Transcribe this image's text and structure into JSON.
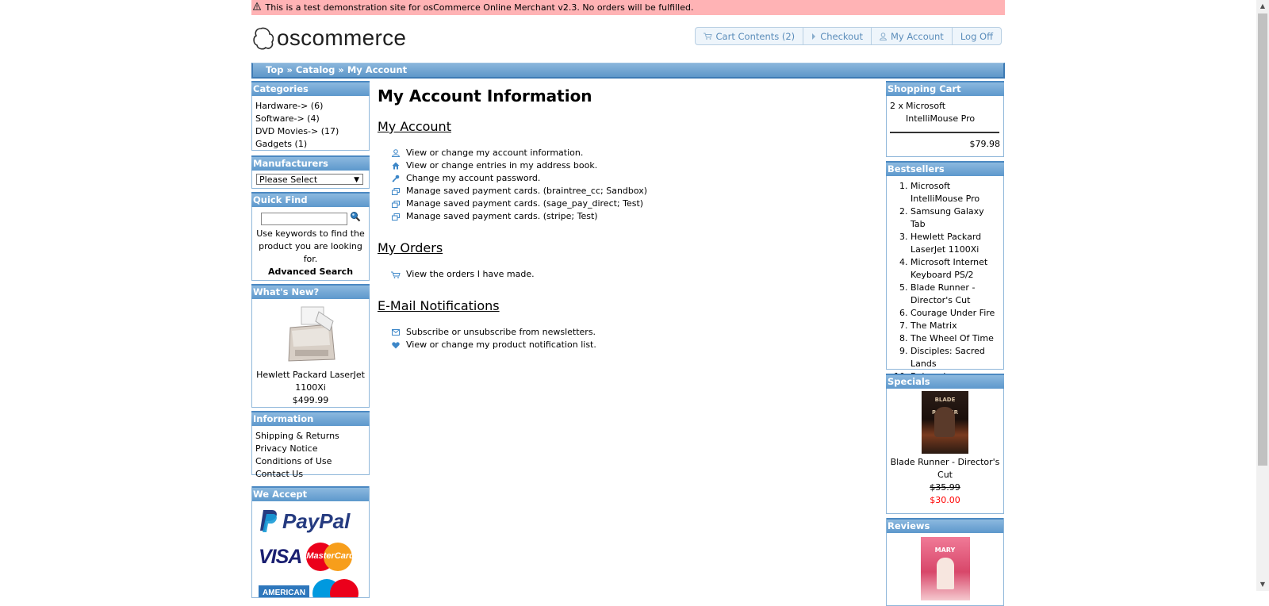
{
  "notice": "This is a test demonstration site for osCommerce Online Merchant v2.3. No orders will be fulfilled.",
  "logo_text": "oscommerce",
  "topnav": {
    "cart": "Cart Contents (2)",
    "checkout": "Checkout",
    "account": "My Account",
    "logoff": "Log Off"
  },
  "breadcrumb": "Top » Catalog » My Account",
  "left": {
    "categories": {
      "title": "Categories",
      "items": [
        "Hardware-> (6)",
        "Software-> (4)",
        "DVD Movies-> (17)",
        "Gadgets (1)"
      ]
    },
    "manufacturers": {
      "title": "Manufacturers",
      "selected": "Please Select"
    },
    "quickfind": {
      "title": "Quick Find",
      "help": "Use keywords to find the product you are looking for.",
      "advanced": "Advanced Search"
    },
    "whatsnew": {
      "title": "What's New?",
      "name": "Hewlett Packard LaserJet 1100Xi",
      "price": "$499.99"
    },
    "information": {
      "title": "Information",
      "items": [
        "Shipping & Returns",
        "Privacy Notice",
        "Conditions of Use",
        "Contact Us"
      ]
    },
    "weaccept": {
      "title": "We Accept",
      "paypal": "PayPal",
      "visa": "VISA",
      "mastercard": "MasterCard",
      "amex": "AMERICAN"
    }
  },
  "main": {
    "title": "My Account Information",
    "account": {
      "heading": "My Account",
      "items": [
        "View or change my account information.",
        "View or change entries in my address book.",
        "Change my account password.",
        "Manage saved payment cards. (braintree_cc; Sandbox)",
        "Manage saved payment cards. (sage_pay_direct; Test)",
        "Manage saved payment cards. (stripe; Test)"
      ]
    },
    "orders": {
      "heading": "My Orders",
      "items": [
        "View the orders I have made."
      ]
    },
    "notifications": {
      "heading": "E-Mail Notifications",
      "items": [
        "Subscribe or unsubscribe from newsletters.",
        "View or change my product notification list."
      ]
    }
  },
  "right": {
    "cart": {
      "title": "Shopping Cart",
      "qty": "2 x",
      "item_line1": "Microsoft",
      "item_line2": "IntelliMouse Pro",
      "total": "$79.98"
    },
    "bestsellers": {
      "title": "Bestsellers",
      "items": [
        "Microsoft IntelliMouse Pro",
        "Samsung Galaxy Tab",
        "Hewlett Packard LaserJet 1100Xi",
        "Microsoft Internet Keyboard PS/2",
        "Blade Runner - Director's Cut",
        "Courage Under Fire",
        "The Matrix",
        "The Wheel Of Time",
        "Disciples: Sacred Lands",
        "Beloved"
      ]
    },
    "specials": {
      "title": "Specials",
      "name": "Blade Runner - Director's Cut",
      "old_price": "$35.99",
      "new_price": "$30.00",
      "poster_text": "BLADE RUNNER"
    },
    "reviews": {
      "title": "Reviews",
      "poster_text": "MARY"
    }
  },
  "colors": {
    "header_blue": "#5e97c9",
    "link_blue": "#5b8dba",
    "notice_bg": "#ffb3b5",
    "special_red": "#ff0000"
  }
}
